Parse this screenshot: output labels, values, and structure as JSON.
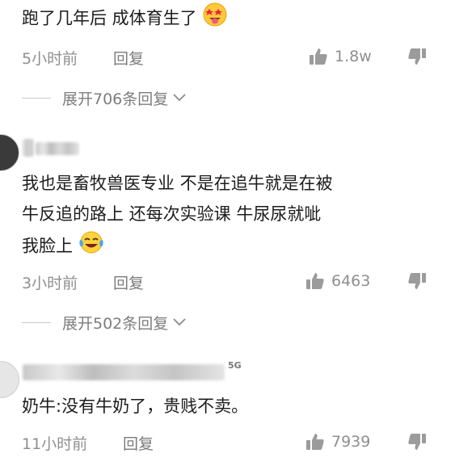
{
  "comments": [
    {
      "text": "跑了几年后 成体育生了",
      "emoji": "star-struck-tongue-emoji",
      "time": "5小时前",
      "reply_label": "回复",
      "likes": "1.8w",
      "expand_label": "展开706条回复"
    },
    {
      "lines": [
        "我也是畜牧兽医专业   不是在追牛就是在被",
        "牛反追的路上   还每次实验课  牛尿尿就呲",
        "我脸上"
      ],
      "emoji": "tears-of-joy-emoji",
      "time": "3小时前",
      "reply_label": "回复",
      "likes": "6463",
      "expand_label": "展开502条回复"
    },
    {
      "text": "奶牛:没有牛奶了，贵贱不卖。",
      "time": "11小时前",
      "reply_label": "回复",
      "likes": "7939",
      "signal": "5G"
    }
  ]
}
